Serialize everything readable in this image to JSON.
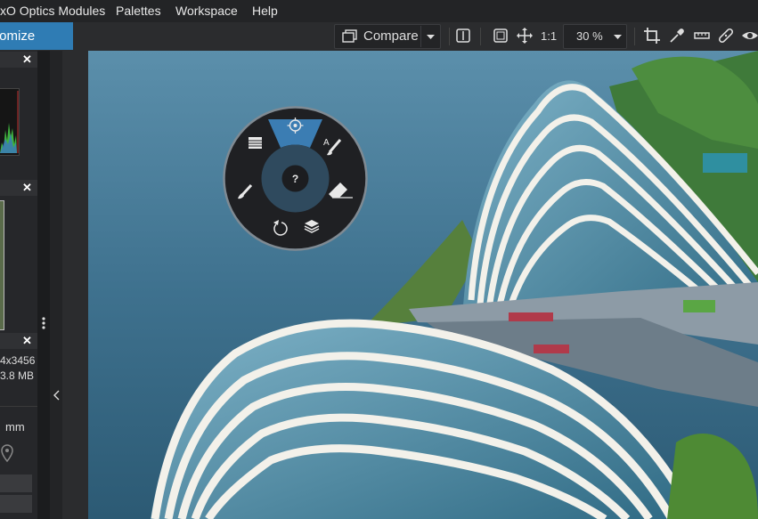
{
  "menu": {
    "items": [
      "xO Optics Modules",
      "Palettes",
      "Workspace",
      "Help"
    ]
  },
  "toolbar": {
    "customize_label": "tomize",
    "compare_label": "Compare",
    "one_to_one_label": "1:1",
    "zoom_value": "30 %"
  },
  "left_panel": {
    "image_size": "4x3456",
    "file_size": "3.8 MB",
    "focal_unit": "mm"
  },
  "radial_menu": {
    "help_label": "?"
  },
  "colors": {
    "accent": "#2f7cb4",
    "background": "#1e1f21",
    "radial_highlight": "#3b7db3"
  }
}
